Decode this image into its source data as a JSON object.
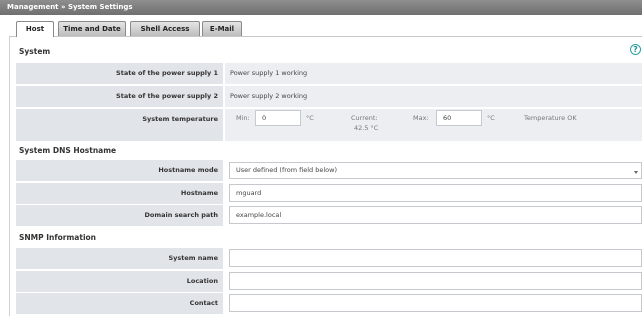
{
  "breadcrumb": {
    "parent": "Management",
    "separator": "»",
    "current": "System Settings"
  },
  "tabs": [
    {
      "label": "Host",
      "active": true
    },
    {
      "label": "Time and Date",
      "active": false
    },
    {
      "label": "Shell Access",
      "active": false
    },
    {
      "label": "E-Mail",
      "active": false
    }
  ],
  "system": {
    "title": "System",
    "help_icon": "help-icon",
    "power1": {
      "label": "State of the power supply 1",
      "value": "Power supply 1 working"
    },
    "power2": {
      "label": "State of the power supply 2",
      "value": "Power supply 2 working"
    },
    "temperature": {
      "label": "System temperature",
      "min_label": "Min:",
      "min_value": "0",
      "min_unit": "°C",
      "current_label": "Current:",
      "current_value": "42.5 °C",
      "max_label": "Max:",
      "max_value": "60",
      "max_unit": "°C",
      "status": "Temperature OK"
    }
  },
  "dns": {
    "title": "System DNS Hostname",
    "mode": {
      "label": "Hostname mode",
      "value": "User defined (from field below)"
    },
    "hostname": {
      "label": "Hostname",
      "value": "mguard"
    },
    "domain": {
      "label": "Domain search path",
      "value": "example.local"
    }
  },
  "snmp": {
    "title": "SNMP Information",
    "system_name": {
      "label": "System name",
      "value": ""
    },
    "location": {
      "label": "Location",
      "value": ""
    },
    "contact": {
      "label": "Contact",
      "value": ""
    }
  },
  "colors": {
    "titlebar": "#7f7f7f",
    "label_bg": "#e1e4e8",
    "value_bg": "#eceef1",
    "help": "#1d8f8f"
  }
}
